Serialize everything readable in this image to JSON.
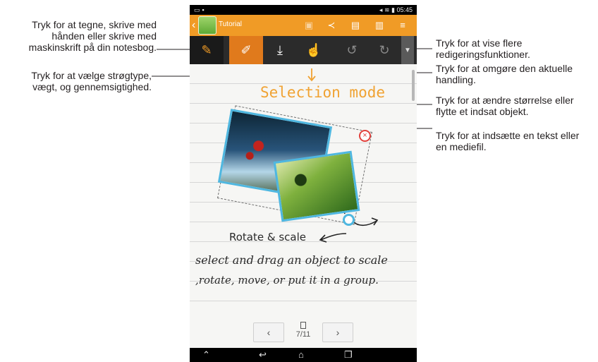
{
  "callouts": {
    "write_mode": "Tryk for at tegne, skrive med\nhånden eller skrive med\nmaskinskrift på din notesbog.",
    "stroke_type": "Tryk for at vælge strøgtype,\nvægt, og gennemsigtighed.",
    "more_tools": "Tryk for at vise flere\nredigeringsfunktioner.",
    "undo": "Tryk for at omgøre den aktuelle\nhandling.",
    "selection": "Tryk for at ændre størrelse eller\nflytte et indsat objekt.",
    "insert": "Tryk for at indsætte en tekst eller\nen mediefil."
  },
  "status_bar": {
    "time": "05:45",
    "left_icons": [
      "notification-icon",
      "image-icon"
    ],
    "right_icons": [
      "silent-icon",
      "wifi-icon",
      "battery-icon"
    ]
  },
  "action_bar": {
    "title": "Tutorial",
    "back_icon": "back-chevron-icon",
    "actions": [
      "save-icon",
      "share-icon",
      "add-page-icon",
      "delete-page-icon",
      "menu-icon"
    ]
  },
  "toolbar": {
    "tools": [
      "write-mode-icon",
      "pen-icon",
      "insert-icon",
      "selection-icon",
      "undo-icon",
      "redo-icon"
    ],
    "more_indicator": "▼"
  },
  "canvas": {
    "heading": "Selection mode",
    "rotate_label": "Rotate & scale",
    "line1": "select and drag an object to scale",
    "line2": ",rotate, move, or put it in a group."
  },
  "pager": {
    "prev": "‹",
    "next": "›",
    "page_count": "7/11"
  },
  "colors": {
    "accent": "#f09b26",
    "toolbar_bg": "#2b2b2b",
    "active_tool": "#e07a1c",
    "selection_blue": "#4fb7e0",
    "delete_red": "#e2413c"
  }
}
